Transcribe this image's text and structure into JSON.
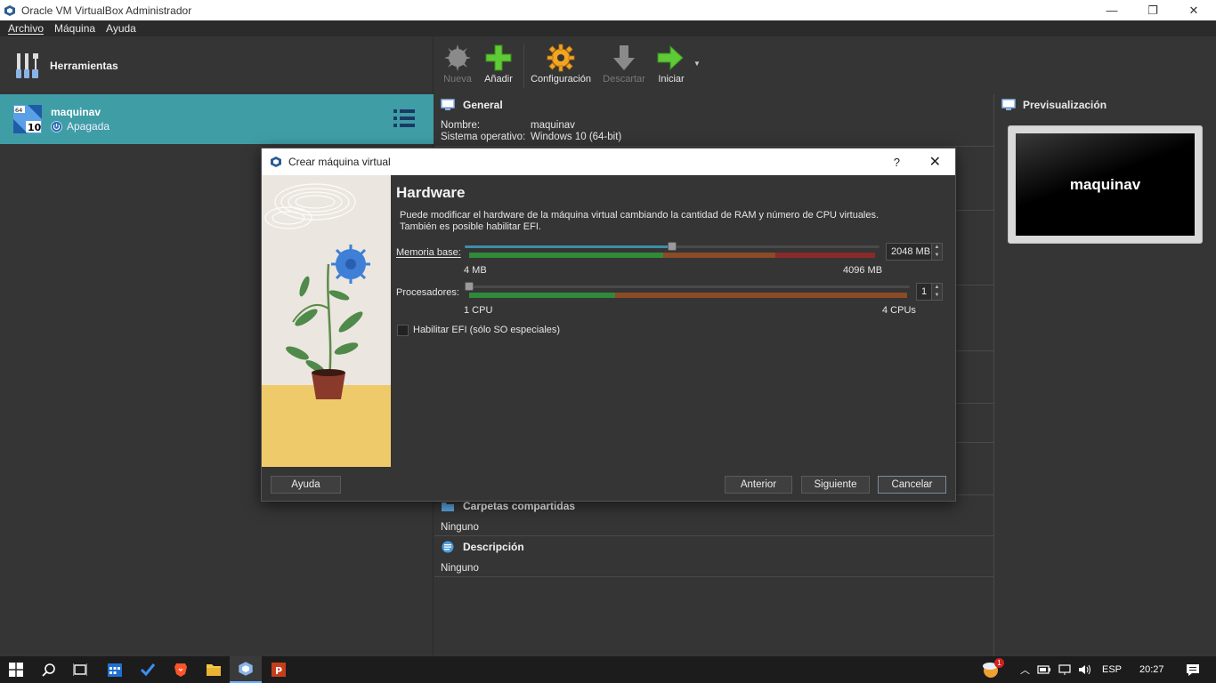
{
  "window": {
    "title": "Oracle VM VirtualBox Administrador",
    "controls": [
      "—",
      "❐",
      "✕"
    ]
  },
  "menu": [
    "Archivo",
    "Máquina",
    "Ayuda"
  ],
  "sidebar": {
    "tools_label": "Herramientas",
    "vm": {
      "name": "maquinav",
      "state": "Apagada",
      "os_badge": "10",
      "os_bits": "64"
    }
  },
  "toolbar": {
    "new": "Nueva",
    "add": "Añadir",
    "settings": "Configuración",
    "discard": "Descartar",
    "start": "Iniciar"
  },
  "details": {
    "general": {
      "title": "General",
      "name_label": "Nombre:",
      "name_value": "maquinav",
      "os_label": "Sistema operativo:",
      "os_value": "Windows 10 (64-bit)"
    },
    "shared_folders": {
      "title": "Carpetas compartidas",
      "value": "Ninguno"
    },
    "description": {
      "title": "Descripción",
      "value": "Ninguno"
    }
  },
  "preview": {
    "title": "Previsualización",
    "screen_text": "maquinav"
  },
  "dialog": {
    "title": "Crear máquina virtual",
    "help_glyph": "?",
    "close_glyph": "✕",
    "heading": "Hardware",
    "description_line1": "Puede modificar el hardware de la máquina virtual cambiando la cantidad de RAM y número de CPU virtuales.",
    "description_line2": "También es posible habilitar EFI.",
    "memory": {
      "label": "Memoria base:",
      "value": "2048 MB",
      "min": "4 MB",
      "max": "4096 MB",
      "fraction": 0.5
    },
    "cpus": {
      "label": "Procesadores:",
      "value": "1",
      "min": "1 CPU",
      "max": "4 CPUs",
      "fraction": 0.0
    },
    "efi": {
      "label": "Habilitar EFI (sólo SO especiales)",
      "checked": false
    },
    "buttons": {
      "help": "Ayuda",
      "back": "Anterior",
      "next": "Siguiente",
      "cancel": "Cancelar"
    }
  },
  "taskbar": {
    "apps": [
      "start-menu",
      "search",
      "task-view",
      "calendar",
      "todo",
      "brave",
      "file-explorer",
      "virtualbox",
      "powerpoint"
    ],
    "lang": "ESP",
    "time": "20:27",
    "notification_count": "1"
  },
  "colors": {
    "accent": "#3f9da6",
    "panel": "#353535",
    "slider_fill": "#3e8ea8",
    "band_green": "#2f8a3a",
    "band_orange": "#8a4b26",
    "band_red": "#8a2a2a"
  }
}
